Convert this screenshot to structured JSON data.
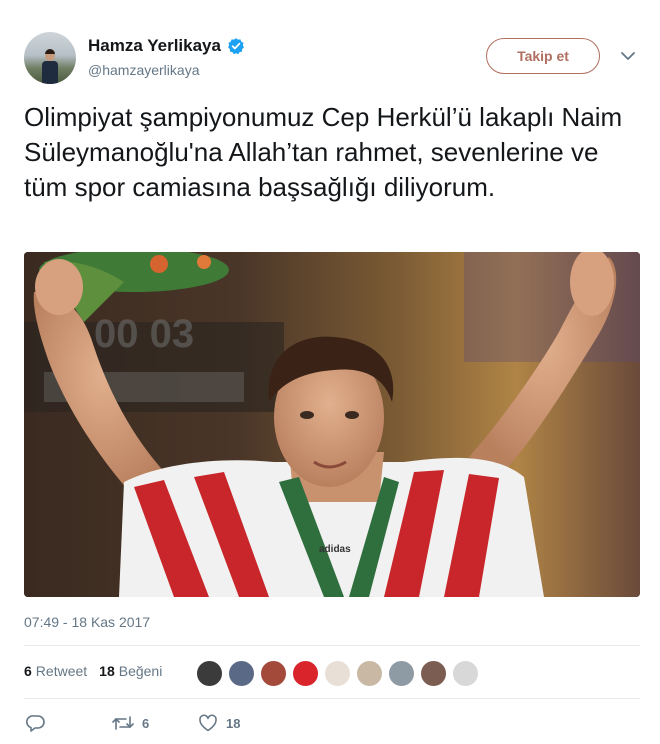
{
  "author": {
    "display_name": "Hamza Yerlikaya",
    "handle": "@hamzayerlikaya",
    "verified": true,
    "avatar_icon": "avatar-photo"
  },
  "header": {
    "follow_label": "Takip et",
    "menu_icon": "chevron-down-icon"
  },
  "tweet": {
    "text": "Olimpiyat şampiyonumuz Cep Herkül’ü lakaplı Naim Süleymanoğlu'na Allah’tan rahmet, sevenlerine ve tüm spor camiasına başsağlığı diliyorum.",
    "media": {
      "type": "photo",
      "visible_text": [
        "adidas"
      ]
    },
    "timestamp": "07:49 - 18 Kas 2017"
  },
  "stats": {
    "retweets": {
      "count": "6",
      "label": "Retweet"
    },
    "likes": {
      "count": "18",
      "label": "Beğeni"
    }
  },
  "likers": [
    {
      "icon": "liker-avatar-1",
      "color": "#3b3b3b"
    },
    {
      "icon": "liker-avatar-2",
      "color": "#5a6a86"
    },
    {
      "icon": "liker-avatar-3",
      "color": "#a34a3a"
    },
    {
      "icon": "liker-avatar-4",
      "color": "#d9242b"
    },
    {
      "icon": "liker-avatar-5",
      "color": "#e8e0d6"
    },
    {
      "icon": "liker-avatar-6",
      "color": "#c9b9a4"
    },
    {
      "icon": "liker-avatar-7",
      "color": "#8e9aa4"
    },
    {
      "icon": "liker-avatar-8",
      "color": "#7b5d52"
    },
    {
      "icon": "liker-avatar-9",
      "color": "#d8d8d8"
    }
  ],
  "actions": {
    "reply": {
      "icon": "reply-icon",
      "count": ""
    },
    "retweet": {
      "icon": "retweet-icon",
      "count": "6"
    },
    "like": {
      "icon": "heart-icon",
      "count": "18"
    }
  },
  "colors": {
    "follow_accent": "#b06f5f",
    "verified_blue": "#1da1f2",
    "secondary_text": "#657786"
  }
}
